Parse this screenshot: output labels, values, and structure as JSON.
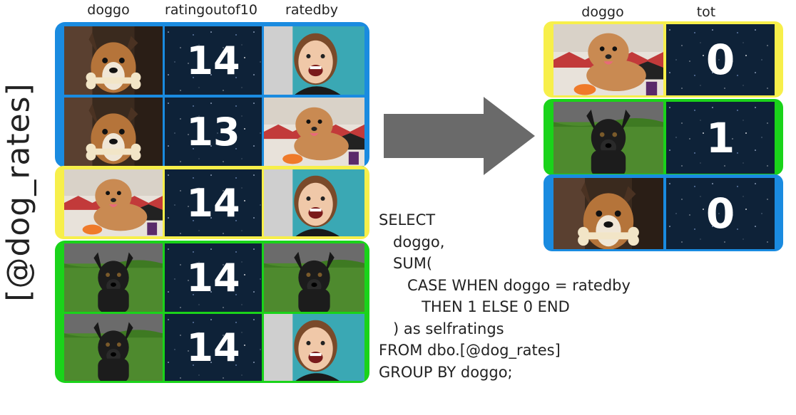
{
  "table_name": "[@dog_rates]",
  "colors": {
    "blue": "#1a8be0",
    "yellow": "#f7ef4a",
    "green": "#1ad31a",
    "arrow": "#6a6a6a",
    "tile_bg": "#0e2238"
  },
  "left_table": {
    "headers": [
      "doggo",
      "ratingoutof10",
      "ratedby"
    ],
    "rows": [
      {
        "doggo": "bonerdog-photo",
        "rating": "14",
        "ratedby": "woman-photo",
        "color": "blue"
      },
      {
        "doggo": "bonerdog-photo",
        "rating": "13",
        "ratedby": "doodle-photo",
        "color": "blue"
      },
      {
        "doggo": "doodle-photo",
        "rating": "14",
        "ratedby": "woman-photo",
        "color": "yellow"
      },
      {
        "doggo": "blackdog-photo",
        "rating": "14",
        "ratedby": "blackdog-photo",
        "color": "green"
      },
      {
        "doggo": "blackdog-photo",
        "rating": "14",
        "ratedby": "woman-photo",
        "color": "green"
      }
    ]
  },
  "right_table": {
    "headers": [
      "doggo",
      "tot"
    ],
    "rows": [
      {
        "doggo": "doodle-photo",
        "tot": "0",
        "color": "yellow"
      },
      {
        "doggo": "blackdog-photo",
        "tot": "1",
        "color": "green"
      },
      {
        "doggo": "bonerdog-photo",
        "tot": "0",
        "color": "blue"
      }
    ]
  },
  "sql_lines": [
    "SELECT",
    "   doggo,",
    "   SUM(",
    "      CASE WHEN doggo = ratedby",
    "         THEN 1 ELSE 0 END",
    "   ) as selfratings",
    "FROM dbo.[@dog_rates]",
    "GROUP BY doggo;"
  ]
}
